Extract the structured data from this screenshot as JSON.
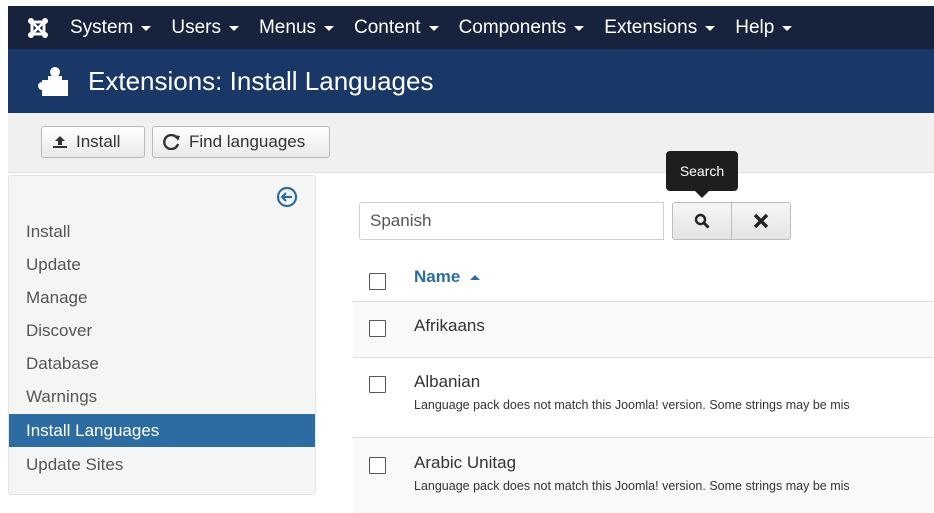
{
  "nav": {
    "items": [
      {
        "label": "System"
      },
      {
        "label": "Users"
      },
      {
        "label": "Menus"
      },
      {
        "label": "Content"
      },
      {
        "label": "Components"
      },
      {
        "label": "Extensions"
      },
      {
        "label": "Help"
      }
    ]
  },
  "header": {
    "title": "Extensions: Install Languages"
  },
  "toolbar": {
    "install_label": "Install",
    "find_label": "Find languages"
  },
  "sidebar": {
    "items": [
      {
        "label": "Install"
      },
      {
        "label": "Update"
      },
      {
        "label": "Manage"
      },
      {
        "label": "Discover"
      },
      {
        "label": "Database"
      },
      {
        "label": "Warnings"
      },
      {
        "label": "Install Languages",
        "active": true
      },
      {
        "label": "Update Sites"
      }
    ]
  },
  "search": {
    "value": "Spanish",
    "tooltip": "Search"
  },
  "table": {
    "column_name": "Name",
    "rows": [
      {
        "name": "Afrikaans",
        "note": ""
      },
      {
        "name": "Albanian",
        "note": "Language pack does not match this Joomla! version. Some strings may be mis"
      },
      {
        "name": "Arabic Unitag",
        "note": "Language pack does not match this Joomla! version. Some strings may be mis"
      }
    ]
  },
  "colors": {
    "navbar": "#17223d",
    "header": "#1a3867",
    "active": "#2d6ca2"
  }
}
